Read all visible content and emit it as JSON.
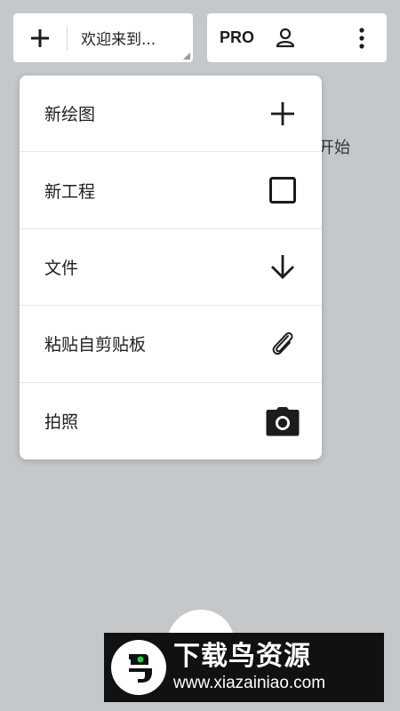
{
  "header": {
    "welcome_text": "欢迎来到...",
    "pro_label": "PRO"
  },
  "background_hint": "开始",
  "menu": {
    "items": [
      {
        "label": "新绘图",
        "icon": "plus-icon"
      },
      {
        "label": "新工程",
        "icon": "square-outline-icon"
      },
      {
        "label": "文件",
        "icon": "arrow-down-icon"
      },
      {
        "label": "粘贴自剪贴板",
        "icon": "paperclip-icon"
      },
      {
        "label": "拍照",
        "icon": "camera-icon"
      }
    ]
  },
  "watermark": {
    "title": "下载鸟资源",
    "url": "www.xiazainiao.com"
  },
  "colors": {
    "background": "#c5c8cb",
    "surface": "#ffffff",
    "text": "#1c1c1c",
    "watermark_bg": "#111111"
  }
}
